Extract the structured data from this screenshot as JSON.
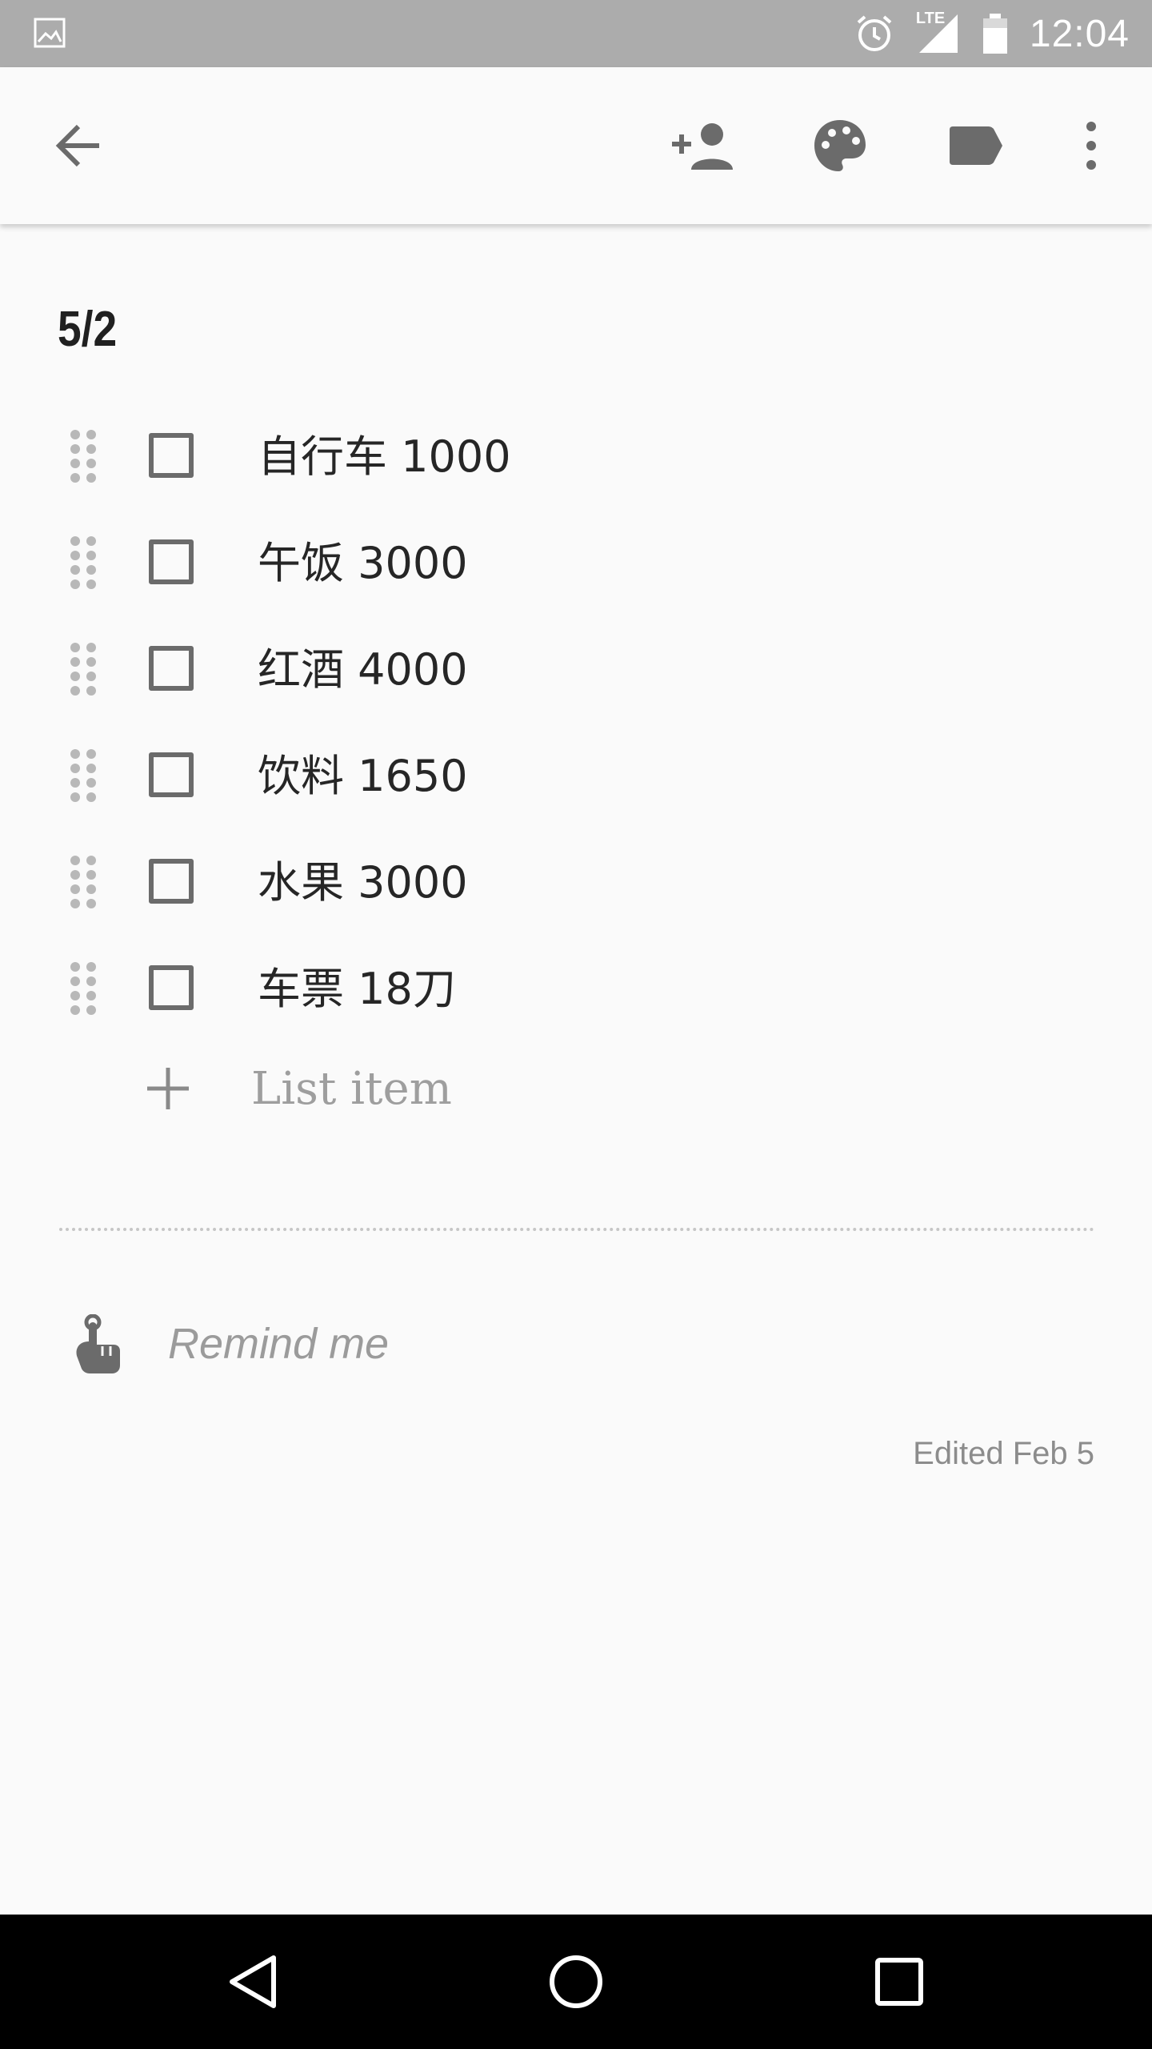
{
  "status_bar": {
    "time": "12:04",
    "network": "LTE"
  },
  "toolbar": {
    "icons": [
      "back-arrow-icon",
      "add-collaborator-icon",
      "palette-icon",
      "label-icon",
      "more-vert-icon"
    ]
  },
  "note": {
    "title": "5/2",
    "items": [
      {
        "text": "自行车 1000",
        "checked": false
      },
      {
        "text": "午饭 3000",
        "checked": false
      },
      {
        "text": "红酒 4000",
        "checked": false
      },
      {
        "text": "饮料 1650",
        "checked": false
      },
      {
        "text": "水果 3000",
        "checked": false
      },
      {
        "text": "车票 18刀",
        "checked": false
      }
    ],
    "add_item_placeholder": "List item",
    "remind_label": "Remind me",
    "edited_label": "Edited Feb 5"
  },
  "colors": {
    "status_bar": "#acacac",
    "background": "#fafafa",
    "icon": "#6b6b6b",
    "nav_bar": "#000000"
  }
}
